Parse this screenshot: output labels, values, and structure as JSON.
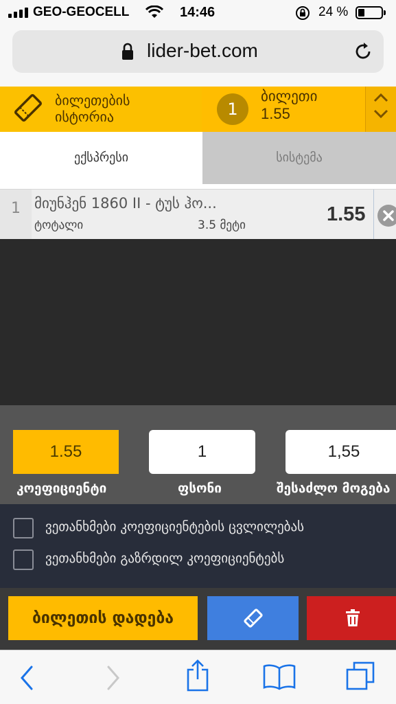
{
  "status_bar": {
    "carrier": "GEO-GEOCELL",
    "time": "14:46",
    "battery_percent": "24 %"
  },
  "browser": {
    "url": "lider-bet.com"
  },
  "header": {
    "history_label_line1": "ბილეთების",
    "history_label_line2": "ისტორია",
    "ticket_count": "1",
    "ticket_label": "ბილეთი",
    "ticket_odds": "1.55"
  },
  "tabs": {
    "express": "ექსპრესი",
    "system": "სისტემა"
  },
  "bet": {
    "number": "1",
    "event": "მიუნჰენ 1860 II - ტუს ჰო...",
    "market": "ტოტალი",
    "selection": "3.5 მეტი",
    "odd": "1.55"
  },
  "totals": {
    "coefficient_value": "1.55",
    "coefficient_label": "კოეფიციენტი",
    "stake_value": "1",
    "stake_label": "ფსონი",
    "possible_win_value": "1,55",
    "possible_win_label": "შესაძლო მოგება"
  },
  "agreements": {
    "accept_odds_change": "ვეთანხმები კოეფიციენტების ცვლილებას",
    "accept_increased_odds": "ვეთანხმები გაზრდილ კოეფიციენტებს"
  },
  "actions": {
    "place_bet": "ბილეთის დადება"
  },
  "colors": {
    "accent_yellow": "#ffbb00",
    "action_blue": "#3f7fdf",
    "delete_red": "#cc1f1f"
  }
}
